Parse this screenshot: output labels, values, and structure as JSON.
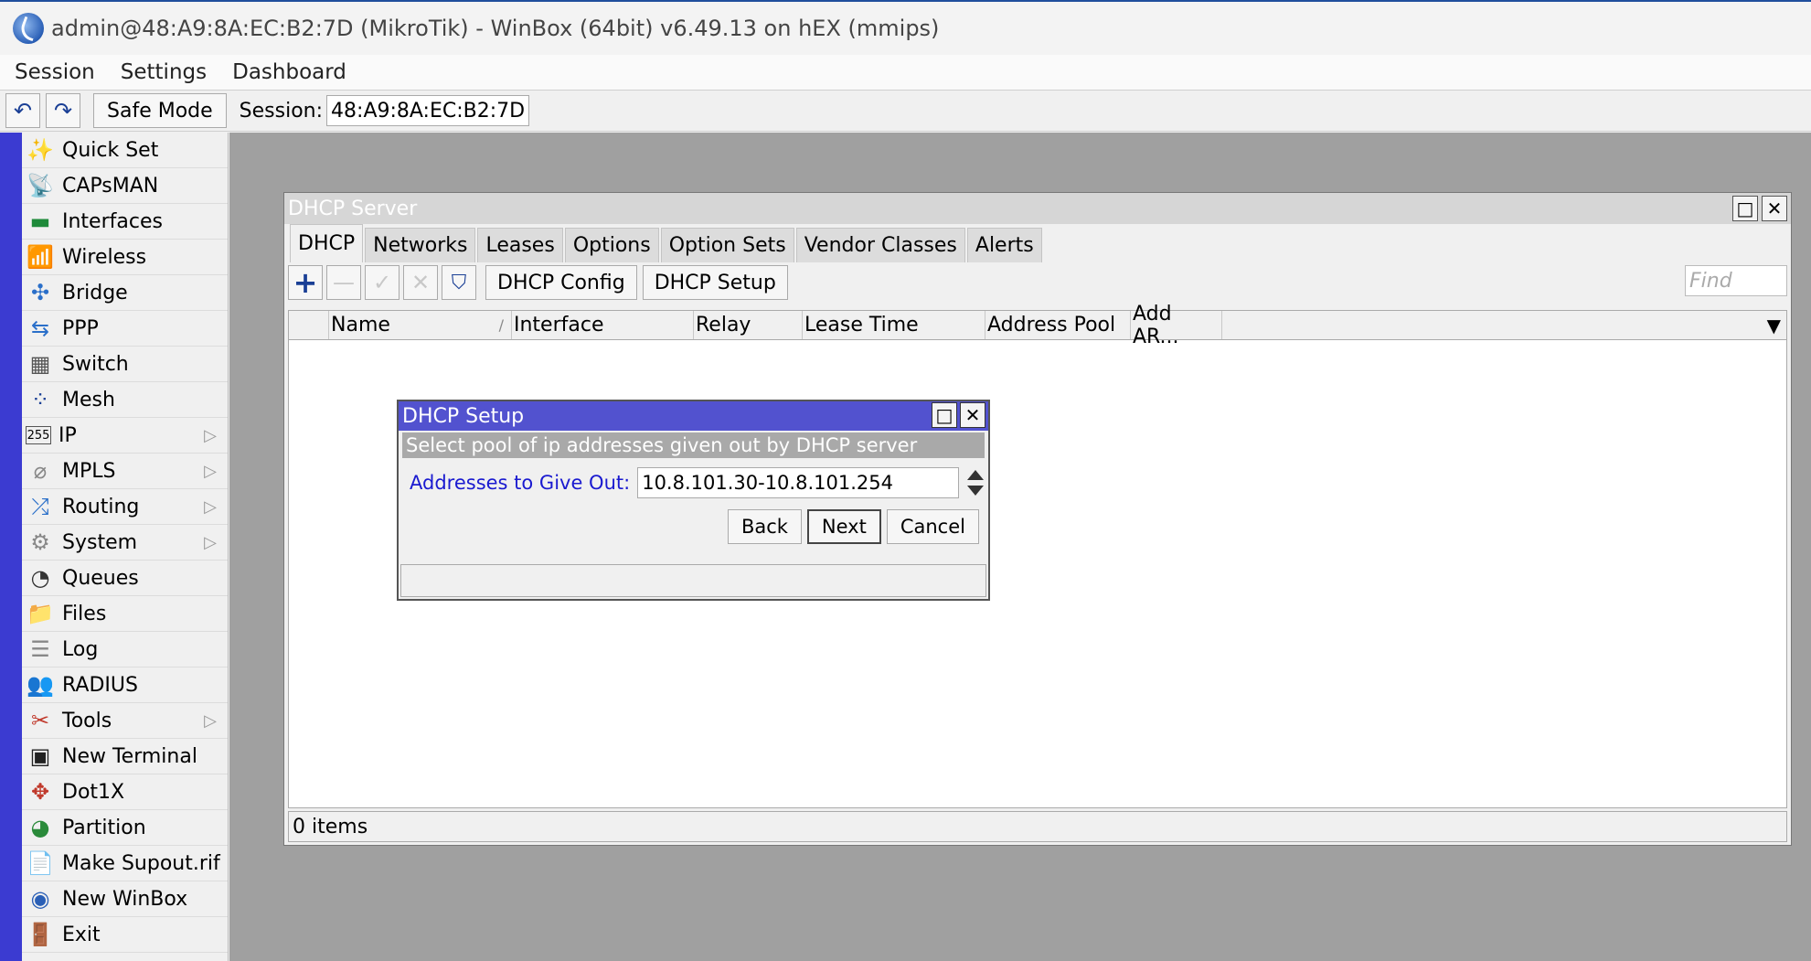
{
  "window": {
    "title": "admin@48:A9:8A:EC:B2:7D (MikroTik) - WinBox (64bit) v6.49.13 on hEX (mmips)"
  },
  "menubar": {
    "items": [
      "Session",
      "Settings",
      "Dashboard"
    ]
  },
  "toolbar": {
    "undo_icon": "↶",
    "redo_icon": "↷",
    "safe_mode_label": "Safe Mode",
    "session_label": "Session:",
    "session_value": "48:A9:8A:EC:B2:7D"
  },
  "sidebar": {
    "items": [
      {
        "label": "Quick Set",
        "icon": "✨",
        "submenu": false
      },
      {
        "label": "CAPsMAN",
        "icon": "📡",
        "submenu": false
      },
      {
        "label": "Interfaces",
        "icon": "▬",
        "submenu": false
      },
      {
        "label": "Wireless",
        "icon": "📶",
        "submenu": false
      },
      {
        "label": "Bridge",
        "icon": "✣",
        "submenu": false
      },
      {
        "label": "PPP",
        "icon": "⇆",
        "submenu": false
      },
      {
        "label": "Switch",
        "icon": "▦",
        "submenu": false
      },
      {
        "label": "Mesh",
        "icon": "⁘",
        "submenu": false
      },
      {
        "label": "IP",
        "icon": "255",
        "submenu": true
      },
      {
        "label": "MPLS",
        "icon": "⌀",
        "submenu": true
      },
      {
        "label": "Routing",
        "icon": "⤮",
        "submenu": true
      },
      {
        "label": "System",
        "icon": "⚙",
        "submenu": true
      },
      {
        "label": "Queues",
        "icon": "◔",
        "submenu": false
      },
      {
        "label": "Files",
        "icon": "📁",
        "submenu": false
      },
      {
        "label": "Log",
        "icon": "☰",
        "submenu": false
      },
      {
        "label": "RADIUS",
        "icon": "👥",
        "submenu": false
      },
      {
        "label": "Tools",
        "icon": "✂",
        "submenu": true
      },
      {
        "label": "New Terminal",
        "icon": "▣",
        "submenu": false
      },
      {
        "label": "Dot1X",
        "icon": "✥",
        "submenu": false
      },
      {
        "label": "Partition",
        "icon": "◕",
        "submenu": false
      },
      {
        "label": "Make Supout.rif",
        "icon": "📄",
        "submenu": false
      },
      {
        "label": "New WinBox",
        "icon": "◉",
        "submenu": false
      },
      {
        "label": "Exit",
        "icon": "🚪",
        "submenu": false
      }
    ],
    "submenu_arrow": "▷"
  },
  "dhcp_server": {
    "title": "DHCP Server",
    "maximize_icon": "□",
    "close_icon": "✕",
    "tabs": [
      "DHCP",
      "Networks",
      "Leases",
      "Options",
      "Option Sets",
      "Vendor Classes",
      "Alerts"
    ],
    "toolbar": {
      "add_icon": "+",
      "remove_icon": "—",
      "enable_icon": "✓",
      "disable_icon": "✕",
      "filter_icon": "⛉",
      "dhcp_config_label": "DHCP Config",
      "dhcp_setup_label": "DHCP Setup",
      "find_placeholder": "Find"
    },
    "columns": [
      "Name",
      "Interface",
      "Relay",
      "Lease Time",
      "Address Pool",
      "Add AR..."
    ],
    "sort_indicator": "/",
    "column_menu_icon": "▼",
    "status": "0 items"
  },
  "dhcp_setup": {
    "title": "DHCP Setup",
    "maximize_icon": "□",
    "close_icon": "✕",
    "subtitle": "Select pool of ip addresses given out by DHCP server",
    "field_label": "Addresses to Give Out:",
    "field_value": "10.8.101.30-10.8.101.254",
    "buttons": {
      "back": "Back",
      "next": "Next",
      "cancel": "Cancel"
    }
  }
}
